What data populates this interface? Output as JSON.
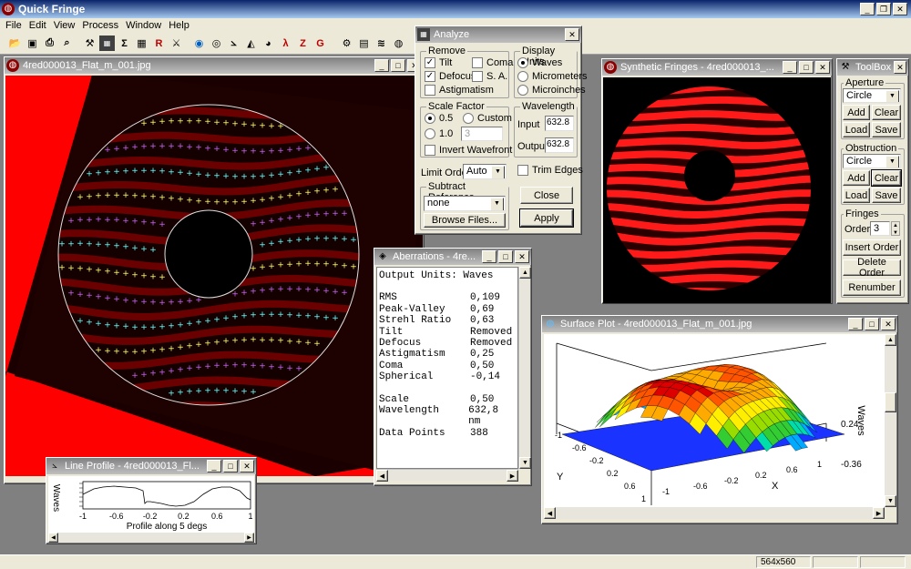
{
  "app": {
    "title": "Quick Fringe"
  },
  "menu": [
    "File",
    "Edit",
    "View",
    "Process",
    "Window",
    "Help"
  ],
  "toolbar": {
    "text_tools": [
      "R",
      "λ",
      "Z",
      "G"
    ]
  },
  "main_window": {
    "title": "4red000013_Flat_m_001.jpg"
  },
  "analyze": {
    "title": "Analyze",
    "remove": {
      "label": "Remove",
      "tilt": "Tilt",
      "defocus": "Defocus",
      "astigmatism": "Astigmatism",
      "coma": "Coma",
      "sa": "S. A."
    },
    "display_units": {
      "label": "Display Units",
      "waves": "Waves",
      "micrometers": "Micrometers",
      "microinches": "Microinches"
    },
    "scale_factor": {
      "label": "Scale Factor",
      "opt1": "0.5",
      "opt2": "1.0",
      "custom": "Custom",
      "custom_value": "3",
      "invert": "Invert Wavefront"
    },
    "wavelength": {
      "label": "Wavelength",
      "input_label": "Input",
      "input_value": "632.8",
      "output_label": "Output",
      "output_value": "632.8"
    },
    "limit_order": {
      "label": "Limit Order",
      "value": "Auto"
    },
    "trim_edges": "Trim Edges",
    "subtract_reference": {
      "label": "Subtract Reference",
      "value": "none",
      "browse": "Browse Files..."
    },
    "close": "Close",
    "apply": "Apply"
  },
  "aberrations": {
    "title": "Aberrations - 4re...",
    "units": "Output Units: Waves",
    "rows": [
      {
        "name": "RMS",
        "value": "0,109"
      },
      {
        "name": "Peak-Valley",
        "value": "0,69"
      },
      {
        "name": "Strehl Ratio",
        "value": "0,63"
      },
      {
        "name": "Tilt",
        "value": "Removed"
      },
      {
        "name": "Defocus",
        "value": "Removed"
      },
      {
        "name": "Astigmatism",
        "value": "0,25"
      },
      {
        "name": "Coma",
        "value": "0,50"
      },
      {
        "name": "Spherical",
        "value": "-0,14"
      }
    ],
    "rows2": [
      {
        "name": "Scale",
        "value": "0,50"
      },
      {
        "name": "Wavelength",
        "value": "632,8 nm"
      },
      {
        "name": "Data Points",
        "value": "388"
      }
    ]
  },
  "synthetic": {
    "title": "Synthetic Fringes - 4red000013_..."
  },
  "toolbox": {
    "title": "ToolBox",
    "aperture": {
      "label": "Aperture",
      "value": "Circle",
      "add": "Add",
      "clear": "Clear",
      "load": "Load",
      "save": "Save"
    },
    "obstruction": {
      "label": "Obstruction",
      "value": "Circle",
      "add": "Add",
      "clear": "Clear",
      "load": "Load",
      "save": "Save"
    },
    "fringes": {
      "label": "Fringes",
      "order_label": "Order",
      "order_value": "3",
      "insert": "Insert Order",
      "delete": "Delete Order",
      "renumber": "Renumber"
    }
  },
  "surface": {
    "title": "Surface Plot - 4red000013_Flat_m_001.jpg",
    "zlabel": "Waves",
    "ztop": "0.24",
    "zbottom": "-0.36",
    "xlabel": "X",
    "ylabel": "Y",
    "xticks": [
      "-1",
      "-0.6",
      "-0.2",
      "0.2",
      "0.6",
      "1"
    ],
    "yticks": [
      "-1",
      "-0.6",
      "-0.2",
      "0.2",
      "0.6",
      "1"
    ]
  },
  "line_profile": {
    "title": "Line Profile - 4red000013_Fl...",
    "ylabel": "Waves",
    "xlabel": "Profile along 5 degs",
    "xticks": [
      "-1",
      "-0.6",
      "-0.2",
      "0.2",
      "0.6",
      "1"
    ]
  },
  "status": {
    "size": "564x560"
  }
}
